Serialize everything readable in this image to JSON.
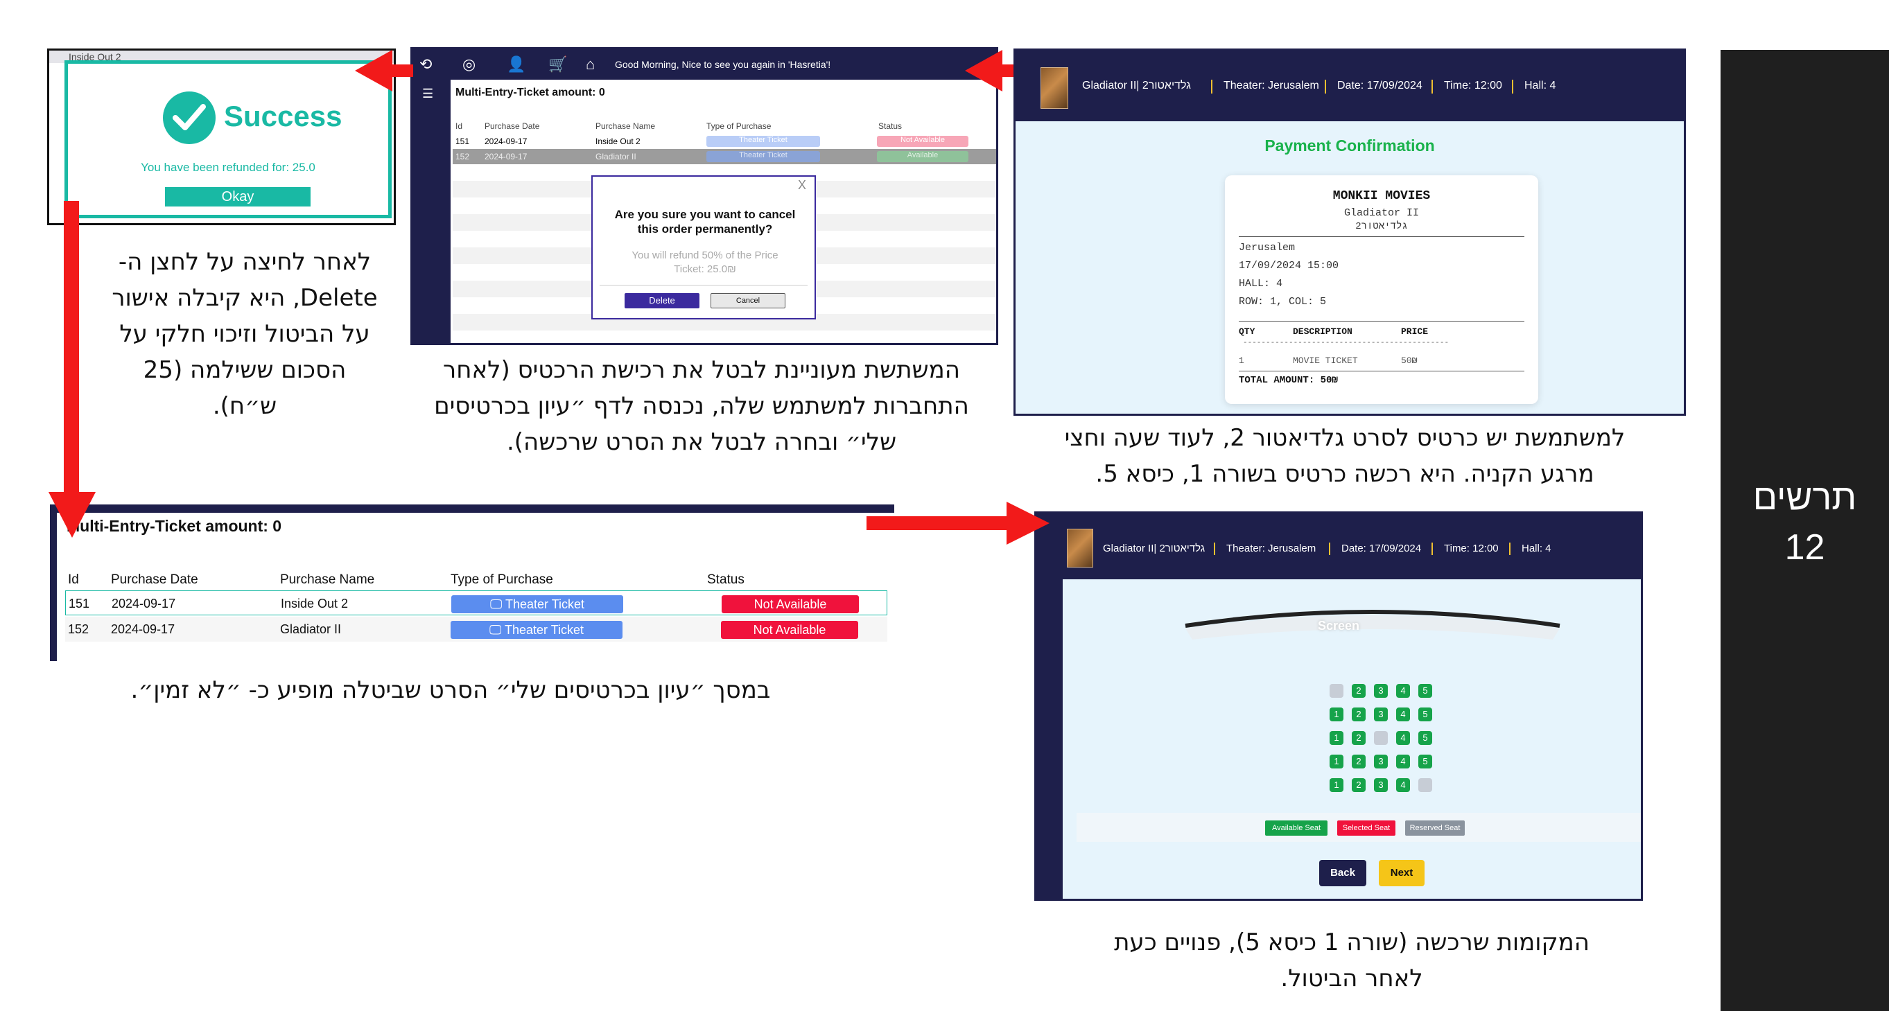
{
  "sidebar": {
    "title_line1": "תרשים",
    "title_line2": "12"
  },
  "success": {
    "strip_text": "Inside Out 2",
    "title": "Success",
    "message": "You have been refunded for: 25.0",
    "button": "Okay"
  },
  "cancel": {
    "greeting": "Good Morning, Nice to see you again in 'Hasretia'!",
    "heading": "Multi-Entry-Ticket amount: 0",
    "columns": [
      "Id",
      "Purchase Date",
      "Purchase Name",
      "Type of Purchase",
      "Status"
    ],
    "rows": [
      {
        "id": "151",
        "date": "2024-09-17",
        "name": "Inside Out 2",
        "type": "Theater Ticket",
        "status": "Not Available"
      },
      {
        "id": "152",
        "date": "2024-09-17",
        "name": "Gladiator II",
        "type": "Theater Ticket",
        "status": "Available"
      }
    ],
    "dialog": {
      "close": "X",
      "question": "Are you sure you want to cancel this order permanently?",
      "refund": "You will refund 50% of the Price Ticket: 25.0₪",
      "delete": "Delete",
      "cancel": "Cancel"
    }
  },
  "movie_bar": {
    "movie": "Gladiator II|  גלדיאטור2",
    "theater": "Theater: Jerusalem",
    "date": "Date: 17/09/2024",
    "time": "Time: 12:00",
    "hall": "Hall: 4"
  },
  "payment": {
    "title": "Payment Confirmation",
    "receipt": {
      "brand": "MONKII MOVIES",
      "movie_en": "Gladiator II",
      "movie_he": "גלדיאטור2",
      "city": "Jerusalem",
      "datetime": "17/09/2024 15:00",
      "hall": "HALL: 4",
      "rowcol": "ROW: 1, COL: 5",
      "col_qty": "QTY",
      "col_desc": "DESCRIPTION",
      "col_price": "PRICE",
      "dashes": "---------------------------------------------",
      "item_qty": "1",
      "item_desc": "MOVIE TICKET",
      "item_price": "50₪",
      "total": "TOTAL AMOUNT: 50₪"
    }
  },
  "seats": {
    "screen_label": "Screen",
    "rows": [
      [
        "",
        "2",
        "3",
        "4",
        "5"
      ],
      [
        "1",
        "2",
        "3",
        "4",
        "5"
      ],
      [
        "1",
        "2",
        "",
        "4",
        "5"
      ],
      [
        "1",
        "2",
        "3",
        "4",
        "5"
      ],
      [
        "1",
        "2",
        "3",
        "4",
        ""
      ]
    ],
    "legend_available": "Available Seat",
    "legend_selected": "Selected Seat",
    "legend_reserved": "Reserved Seat",
    "back": "Back",
    "next": "Next"
  },
  "tickets": {
    "heading": "Multi-Entry-Ticket amount: 0",
    "columns": [
      "Id",
      "Purchase Date",
      "Purchase Name",
      "Type of Purchase",
      "Status"
    ],
    "rows": [
      {
        "id": "151",
        "date": "2024-09-17",
        "name": "Inside Out 2",
        "type": "Theater Ticket",
        "status": "Not Available"
      },
      {
        "id": "152",
        "date": "2024-09-17",
        "name": "Gladiator II",
        "type": "Theater Ticket",
        "status": "Not Available"
      }
    ]
  },
  "captions": {
    "success": "לאחר לחיצה על לחצן ה-Delete, היא קיבלה אישור על הביטול וזיכוי חלקי על הסכום ששילמה (25 ש״ח).",
    "cancel": "המשתשת מעוניינת לבטל את רכישת הרכטיס (לאחר התחברות למשתמש שלה, נכנסה לדף ״עיון בכרטיסים שלי״ ובחרה לבטל את הסרט שרכשה).",
    "payment": "למשתמשת יש כרטיס לסרט גלדיאטור 2, לעוד שעה וחצי מרגע הקניה.  היא רכשה כרטיס בשורה 1, כיסא 5.",
    "tickets": "במסך ״עיון בכרטיסים שלי״ הסרט שביטלה מופיע כ- ״לא זמין״.",
    "seats": "המקומות שרכשה (שורה 1 כיסא 5), פנויים כעת לאחר הביטול."
  },
  "colors": {
    "navy": "#1e1f4b",
    "teal": "#19b9a4",
    "green": "#16a34a",
    "red": "#f0123c",
    "blue": "#5b8def",
    "arrow": "#f21a1a",
    "yellow": "#f5c518"
  }
}
